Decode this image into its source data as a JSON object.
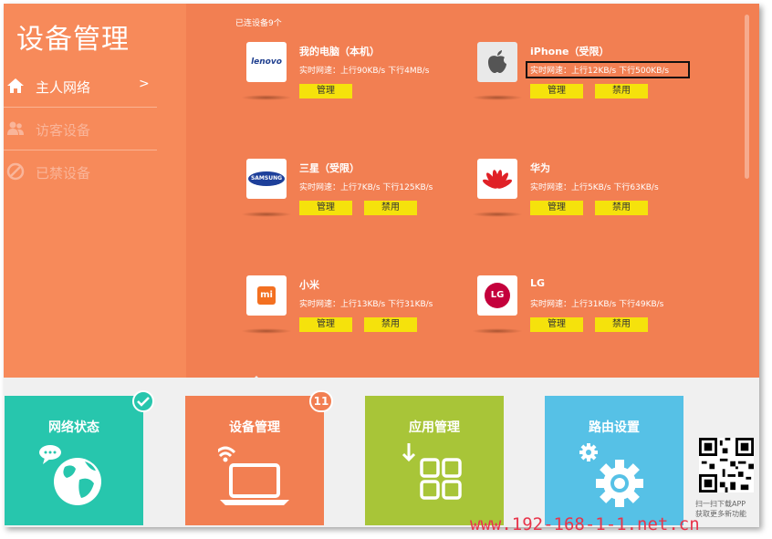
{
  "app": {
    "title": "设备管理"
  },
  "sidebar": {
    "items": [
      {
        "label": "主人网络",
        "arrow": ">"
      },
      {
        "label": "访客设备"
      },
      {
        "label": "已禁设备"
      }
    ]
  },
  "content": {
    "connected_label": "已连设备9个",
    "manage_label": "管理",
    "ban_label": "禁用",
    "devices": [
      {
        "name": "我的电脑（本机）",
        "speed": "实时网速：上行90KB/s  下行4MB/s",
        "logo": "lenovo-logo",
        "logo_text": "lenovo"
      },
      {
        "name": "iPhone（受限）",
        "speed": "实时网速：上行12KB/s  下行500KB/s",
        "logo": "apple-logo"
      },
      {
        "name": "三星（受限）",
        "speed": "实时网速：上行7KB/s  下行125KB/s",
        "logo": "samsung-logo",
        "logo_text": "SAMSUNG"
      },
      {
        "name": "华为",
        "speed": "实时网速：上行5KB/s  下行63KB/s",
        "logo": "huawei-logo"
      },
      {
        "name": "小米",
        "speed": "实时网速：上行13KB/s  下行31KB/s",
        "logo": "xiaomi-logo",
        "logo_text": "mi"
      },
      {
        "name": "LG",
        "speed": "实时网速：上行31KB/s  下行49KB/s",
        "logo": "lg-logo",
        "logo_text": "LG"
      }
    ]
  },
  "tiles": [
    {
      "label": "网络状态",
      "icon": "globe-chat-icon",
      "color": "#27c6ad"
    },
    {
      "label": "设备管理",
      "icon": "laptop-wifi-icon",
      "color": "#f27f52",
      "badge": "11"
    },
    {
      "label": "应用管理",
      "icon": "apps-grid-icon",
      "color": "#a8c538"
    },
    {
      "label": "路由设置",
      "icon": "gears-icon",
      "color": "#56c1e6"
    }
  ],
  "qr": {
    "caption_line1": "扫一扫下载APP",
    "caption_line2": "获取更多新功能"
  },
  "watermark": "www.192-168-1-1.net.cn"
}
